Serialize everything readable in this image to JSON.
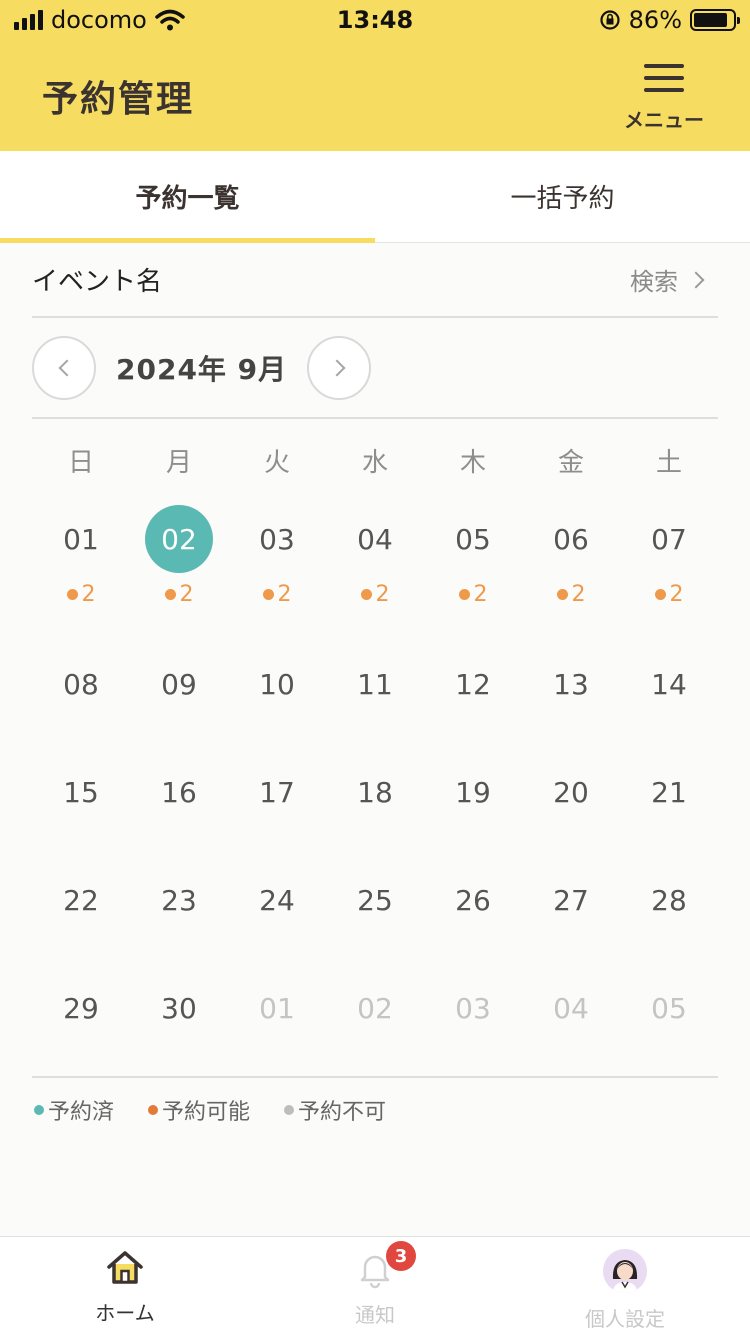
{
  "status_bar": {
    "carrier": "docomo",
    "time": "13:48",
    "battery_percent": "86%",
    "battery_level": 0.86
  },
  "header": {
    "title": "予約管理",
    "menu_label": "メニュー"
  },
  "tabs": [
    {
      "label": "予約一覧",
      "active": true
    },
    {
      "label": "一括予約",
      "active": false
    }
  ],
  "event": {
    "label": "イベント名",
    "search_label": "検索"
  },
  "calendar": {
    "month_label": "2024年 9月",
    "weekdays": [
      "日",
      "月",
      "火",
      "水",
      "木",
      "金",
      "土"
    ],
    "weeks": [
      [
        {
          "day": "01",
          "count": "2"
        },
        {
          "day": "02",
          "count": "2",
          "selected": true
        },
        {
          "day": "03",
          "count": "2"
        },
        {
          "day": "04",
          "count": "2"
        },
        {
          "day": "05",
          "count": "2"
        },
        {
          "day": "06",
          "count": "2"
        },
        {
          "day": "07",
          "count": "2"
        }
      ],
      [
        {
          "day": "08"
        },
        {
          "day": "09"
        },
        {
          "day": "10"
        },
        {
          "day": "11"
        },
        {
          "day": "12"
        },
        {
          "day": "13"
        },
        {
          "day": "14"
        }
      ],
      [
        {
          "day": "15"
        },
        {
          "day": "16"
        },
        {
          "day": "17"
        },
        {
          "day": "18"
        },
        {
          "day": "19"
        },
        {
          "day": "20"
        },
        {
          "day": "21"
        }
      ],
      [
        {
          "day": "22"
        },
        {
          "day": "23"
        },
        {
          "day": "24"
        },
        {
          "day": "25"
        },
        {
          "day": "26"
        },
        {
          "day": "27"
        },
        {
          "day": "28"
        }
      ],
      [
        {
          "day": "29"
        },
        {
          "day": "30"
        },
        {
          "day": "01",
          "other_month": true
        },
        {
          "day": "02",
          "other_month": true
        },
        {
          "day": "03",
          "other_month": true
        },
        {
          "day": "04",
          "other_month": true
        },
        {
          "day": "05",
          "other_month": true
        }
      ]
    ]
  },
  "legend": [
    {
      "label": "予約済",
      "color": "#5ab9b3"
    },
    {
      "label": "予約可能",
      "color": "#e07b3a"
    },
    {
      "label": "予約不可",
      "color": "#bdbdbd"
    }
  ],
  "bottom_nav": [
    {
      "label": "ホーム",
      "icon": "home-icon",
      "active": true
    },
    {
      "label": "通知",
      "icon": "bell-icon",
      "active": false,
      "badge": "3"
    },
    {
      "label": "個人設定",
      "icon": "avatar-icon",
      "active": false
    }
  ],
  "colors": {
    "brand_yellow": "#f7dc62",
    "selected_teal": "#5ab9b3",
    "count_orange": "#ee9a4a",
    "badge_red": "#e0473f"
  }
}
